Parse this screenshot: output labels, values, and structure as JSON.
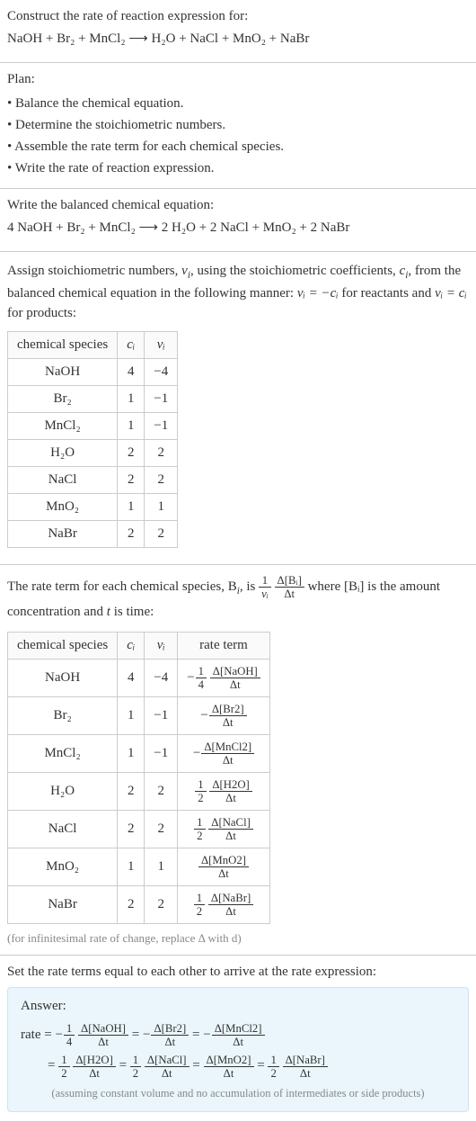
{
  "intro": {
    "title": "Construct the rate of reaction expression for:",
    "equation_lhs": "NaOH + Br",
    "equation": "NaOH + Br₂ + MnCl₂  ⟶  H₂O + NaCl + MnO₂ + NaBr"
  },
  "plan": {
    "heading": "Plan:",
    "items": [
      "• Balance the chemical equation.",
      "• Determine the stoichiometric numbers.",
      "• Assemble the rate term for each chemical species.",
      "• Write the rate of reaction expression."
    ]
  },
  "balanced": {
    "heading": "Write the balanced chemical equation:",
    "equation": "4 NaOH + Br₂ + MnCl₂  ⟶  2 H₂O + 2 NaCl + MnO₂ + 2 NaBr"
  },
  "stoich": {
    "intro_a": "Assign stoichiometric numbers, ",
    "nu": "ν",
    "sub_i": "i",
    "intro_b": ", using the stoichiometric coefficients, ",
    "c": "c",
    "intro_c": ", from the balanced chemical equation in the following manner: ",
    "rel_react": "νᵢ = −cᵢ",
    "for_react": " for reactants and ",
    "rel_prod": "νᵢ = cᵢ",
    "for_prod": " for products:",
    "headers": {
      "species": "chemical species",
      "ci": "cᵢ",
      "nui": "νᵢ"
    },
    "rows": [
      {
        "species": "NaOH",
        "ci": "4",
        "nui": "−4"
      },
      {
        "species": "Br₂",
        "ci": "1",
        "nui": "−1"
      },
      {
        "species": "MnCl₂",
        "ci": "1",
        "nui": "−1"
      },
      {
        "species": "H₂O",
        "ci": "2",
        "nui": "2"
      },
      {
        "species": "NaCl",
        "ci": "2",
        "nui": "2"
      },
      {
        "species": "MnO₂",
        "ci": "1",
        "nui": "1"
      },
      {
        "species": "NaBr",
        "ci": "2",
        "nui": "2"
      }
    ]
  },
  "rateterm": {
    "intro_a": "The rate term for each chemical species, B",
    "intro_b": ", is ",
    "one": "1",
    "nu_i": "νᵢ",
    "delta_bi": "Δ[Bᵢ]",
    "delta_t": "Δt",
    "intro_c": " where [Bᵢ] is the amount concentration and ",
    "t": "t",
    "intro_d": " is time:",
    "headers": {
      "species": "chemical species",
      "ci": "cᵢ",
      "nui": "νᵢ",
      "rate": "rate term"
    },
    "rows": [
      {
        "species": "NaOH",
        "ci": "4",
        "nui": "−4",
        "neg": "−",
        "coef_num": "1",
        "coef_den": "4",
        "dnum": "Δ[NaOH]",
        "dden": "Δt"
      },
      {
        "species": "Br₂",
        "ci": "1",
        "nui": "−1",
        "neg": "−",
        "coef_num": "",
        "coef_den": "",
        "dnum": "Δ[Br2]",
        "dden": "Δt"
      },
      {
        "species": "MnCl₂",
        "ci": "1",
        "nui": "−1",
        "neg": "−",
        "coef_num": "",
        "coef_den": "",
        "dnum": "Δ[MnCl2]",
        "dden": "Δt"
      },
      {
        "species": "H₂O",
        "ci": "2",
        "nui": "2",
        "neg": "",
        "coef_num": "1",
        "coef_den": "2",
        "dnum": "Δ[H2O]",
        "dden": "Δt"
      },
      {
        "species": "NaCl",
        "ci": "2",
        "nui": "2",
        "neg": "",
        "coef_num": "1",
        "coef_den": "2",
        "dnum": "Δ[NaCl]",
        "dden": "Δt"
      },
      {
        "species": "MnO₂",
        "ci": "1",
        "nui": "1",
        "neg": "",
        "coef_num": "",
        "coef_den": "",
        "dnum": "Δ[MnO2]",
        "dden": "Δt"
      },
      {
        "species": "NaBr",
        "ci": "2",
        "nui": "2",
        "neg": "",
        "coef_num": "1",
        "coef_den": "2",
        "dnum": "Δ[NaBr]",
        "dden": "Δt"
      }
    ],
    "note": "(for infinitesimal rate of change, replace Δ with d)"
  },
  "final": {
    "heading": "Set the rate terms equal to each other to arrive at the rate expression:",
    "answer_label": "Answer:",
    "rate_eq": "rate = ",
    "eq": " = ",
    "terms": [
      {
        "neg": "−",
        "cnum": "1",
        "cden": "4",
        "dnum": "Δ[NaOH]",
        "dden": "Δt"
      },
      {
        "neg": "−",
        "cnum": "",
        "cden": "",
        "dnum": "Δ[Br2]",
        "dden": "Δt"
      },
      {
        "neg": "−",
        "cnum": "",
        "cden": "",
        "dnum": "Δ[MnCl2]",
        "dden": "Δt"
      },
      {
        "neg": "",
        "cnum": "1",
        "cden": "2",
        "dnum": "Δ[H2O]",
        "dden": "Δt"
      },
      {
        "neg": "",
        "cnum": "1",
        "cden": "2",
        "dnum": "Δ[NaCl]",
        "dden": "Δt"
      },
      {
        "neg": "",
        "cnum": "",
        "cden": "",
        "dnum": "Δ[MnO2]",
        "dden": "Δt"
      },
      {
        "neg": "",
        "cnum": "1",
        "cden": "2",
        "dnum": "Δ[NaBr]",
        "dden": "Δt"
      }
    ],
    "note": "(assuming constant volume and no accumulation of intermediates or side products)"
  },
  "chart_data": {
    "type": "table",
    "title": "Stoichiometric numbers and rate terms",
    "columns": [
      "chemical species",
      "cᵢ",
      "νᵢ",
      "rate term"
    ],
    "rows": [
      [
        "NaOH",
        4,
        -4,
        "−(1/4) Δ[NaOH]/Δt"
      ],
      [
        "Br₂",
        1,
        -1,
        "−Δ[Br2]/Δt"
      ],
      [
        "MnCl₂",
        1,
        -1,
        "−Δ[MnCl2]/Δt"
      ],
      [
        "H₂O",
        2,
        2,
        "(1/2) Δ[H2O]/Δt"
      ],
      [
        "NaCl",
        2,
        2,
        "(1/2) Δ[NaCl]/Δt"
      ],
      [
        "MnO₂",
        1,
        1,
        "Δ[MnO2]/Δt"
      ],
      [
        "NaBr",
        2,
        2,
        "(1/2) Δ[NaBr]/Δt"
      ]
    ]
  }
}
